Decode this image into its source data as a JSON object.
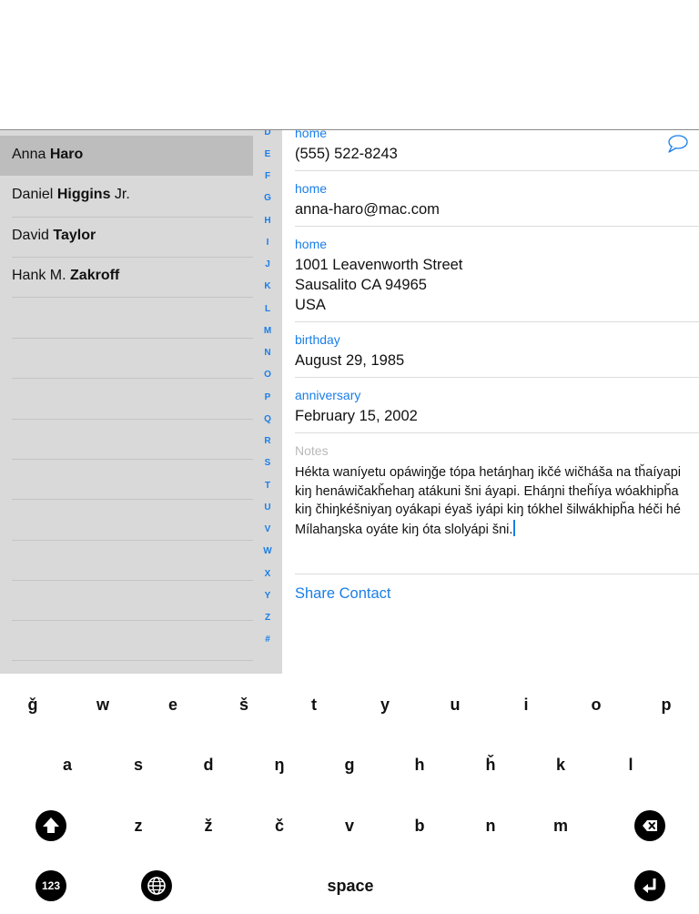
{
  "contacts": {
    "list": [
      {
        "first": "Anna",
        "last": "Haro",
        "suffix": "",
        "selected": true
      },
      {
        "first": "Daniel",
        "last": "Higgins",
        "suffix": " Jr.",
        "selected": false
      },
      {
        "first": "David",
        "last": "Taylor",
        "suffix": "",
        "selected": false
      },
      {
        "first": "Hank M.",
        "last": "Zakroff",
        "suffix": "",
        "selected": false
      }
    ],
    "index_letters": [
      "D",
      "E",
      "F",
      "G",
      "H",
      "I",
      "J",
      "K",
      "L",
      "M",
      "N",
      "O",
      "P",
      "Q",
      "R",
      "S",
      "T",
      "U",
      "V",
      "W",
      "X",
      "Y",
      "Z",
      "#"
    ]
  },
  "detail": {
    "phone": {
      "label": "home",
      "value": "(555) 522-8243"
    },
    "email": {
      "label": "home",
      "value": "anna-haro@mac.com"
    },
    "address": {
      "label": "home",
      "line1": "1001  Leavenworth Street",
      "line2": "Sausalito CA 94965",
      "line3": "USA"
    },
    "birthday": {
      "label": "birthday",
      "value": "August 29, 1985"
    },
    "anniversary": {
      "label": "anniversary",
      "value": "February 15, 2002"
    },
    "notes": {
      "label": "Notes",
      "text": "Hékta waníyetu opáwiŋǧe tópa hetáŋhaŋ ikčé wičháša na tȟaíyapi kiŋ henáwičakȟehaŋ atákuni šni áyapi. Eháŋni theȟíya wóakhipȟa kiŋ čhiŋkéšniyaŋ oyákapi éyaš iyápi kiŋ tókhel šilwákhipȟa héči hé Mílahaŋska oyáte kiŋ óta slolyápi šni."
    },
    "share_label": "Share Contact",
    "message_icon": "message-bubble-icon",
    "accent_color": "#1a7ee8"
  },
  "keyboard": {
    "row1": [
      "ǧ",
      "w",
      "e",
      "š",
      "t",
      "y",
      "u",
      "i",
      "o",
      "p"
    ],
    "row2": [
      "a",
      "s",
      "d",
      "ŋ",
      "g",
      "h",
      "ȟ",
      "k",
      "l"
    ],
    "row3": [
      "z",
      "ž",
      "č",
      "v",
      "b",
      "n",
      "m"
    ],
    "shift_icon": "shift-up-arrow-icon",
    "delete_icon": "delete-backspace-icon",
    "numbers_label": "123",
    "globe_icon": "globe-icon",
    "space_label": "space",
    "return_icon": "return-arrow-icon"
  }
}
